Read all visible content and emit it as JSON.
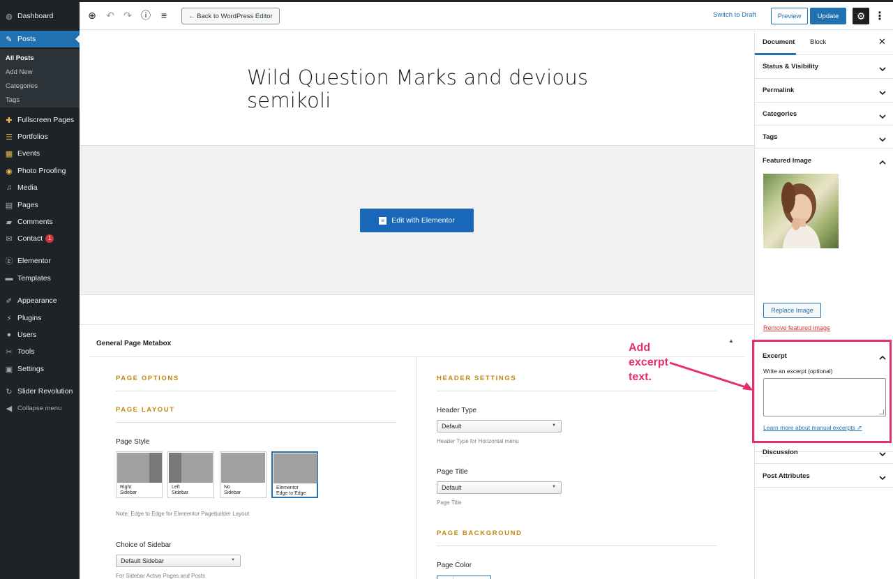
{
  "admin_menu": {
    "items": [
      {
        "label": "Dashboard",
        "icon": "dashboard-icon"
      },
      {
        "label": "Posts",
        "icon": "pin-icon"
      },
      {
        "label": "Fullscreen Pages",
        "icon": "plus-icon"
      },
      {
        "label": "Portfolios",
        "icon": "grid-icon"
      },
      {
        "label": "Events",
        "icon": "calendar-icon"
      },
      {
        "label": "Photo Proofing",
        "icon": "eye-icon"
      },
      {
        "label": "Media",
        "icon": "media-icon"
      },
      {
        "label": "Pages",
        "icon": "page-icon"
      },
      {
        "label": "Comments",
        "icon": "comment-icon"
      },
      {
        "label": "Contact",
        "icon": "mail-icon",
        "badge": "1"
      },
      {
        "label": "Elementor",
        "icon": "elementor-icon"
      },
      {
        "label": "Templates",
        "icon": "folder-icon"
      },
      {
        "label": "Appearance",
        "icon": "brush-icon"
      },
      {
        "label": "Plugins",
        "icon": "plug-icon"
      },
      {
        "label": "Users",
        "icon": "user-icon"
      },
      {
        "label": "Tools",
        "icon": "wrench-icon"
      },
      {
        "label": "Settings",
        "icon": "sliders-icon"
      },
      {
        "label": "Slider Revolution",
        "icon": "refresh-icon"
      },
      {
        "label": "Collapse menu",
        "icon": "collapse-icon"
      }
    ],
    "posts_submenu": [
      "All Posts",
      "Add New",
      "Categories",
      "Tags"
    ]
  },
  "toolbar": {
    "back_label": "← Back to WordPress Editor",
    "switch_draft": "Switch to Draft",
    "preview": "Preview",
    "update": "Update"
  },
  "editor": {
    "post_title": "Wild Question Marks and devious semikoli",
    "elementor_button": "Edit with Elementor"
  },
  "metabox": {
    "title": "General Page Metabox",
    "left": {
      "page_options": "PAGE OPTIONS",
      "page_layout": "PAGE LAYOUT",
      "page_style_label": "Page Style",
      "styles": [
        {
          "line1": "Right",
          "line2": "Sidebar"
        },
        {
          "line1": "Left",
          "line2": "Sidebar"
        },
        {
          "line1": "No",
          "line2": "Sidebar"
        },
        {
          "line1": "Elementor",
          "line2": "Edge to Edge"
        }
      ],
      "style_note": "Note: Edge to Edge for Elementor Pagebuilder Layout",
      "sidebar_label": "Choice of Sidebar",
      "sidebar_value": "Default Sidebar",
      "sidebar_note": "For Sidebar Active Pages and Posts"
    },
    "right": {
      "header_settings": "HEADER SETTINGS",
      "header_type_label": "Header Type",
      "header_type_value": "Default",
      "header_type_note": "Header Type for Horizontal menu",
      "page_title_label": "Page Title",
      "page_title_value": "Default",
      "page_title_note": "Page Title",
      "page_background": "PAGE BACKGROUND",
      "page_color_label": "Page Color"
    }
  },
  "sidebar": {
    "tabs": [
      "Document",
      "Block"
    ],
    "panels": {
      "status": "Status & Visibility",
      "permalink": "Permalink",
      "categories": "Categories",
      "tags": "Tags",
      "featured": "Featured Image",
      "excerpt": "Excerpt",
      "discussion": "Discussion",
      "attributes": "Post Attributes"
    },
    "replace_image": "Replace Image",
    "remove_image": "Remove featured image",
    "excerpt_label": "Write an excerpt (optional)",
    "learn_more": "Learn more about manual excerpts"
  },
  "annotation": {
    "line1": "Add",
    "line2": "excerpt",
    "line3": "text.",
    "color": "#e6306a"
  },
  "colors": {
    "admin_bg": "#1d2327",
    "accent": "#2271b1",
    "section_head": "#c0870c",
    "elementor": "#1967b9"
  }
}
